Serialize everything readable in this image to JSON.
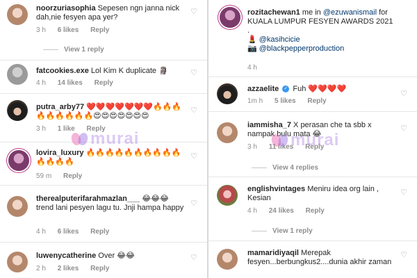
{
  "left": [
    {
      "user": "noorzuriasophia",
      "text": "Sepesen ngn janna nick dah,nie fesyen apa yer?",
      "time": "3 h",
      "likes": "6 likes",
      "reply": "Reply",
      "view_replies": "View 1 reply"
    },
    {
      "user": "fatcookies.exe",
      "text": "Lol Kim K duplicate 🗿",
      "time": "4 h",
      "likes": "14 likes",
      "reply": "Reply"
    },
    {
      "user": "putra_arby77",
      "text": "❤️❤️❤️❤️❤️❤️❤️🔥🔥🔥🔥🔥🔥🔥🔥🔥😍😍😍😍😍😍😍",
      "time": "3 h",
      "likes": "1 like",
      "reply": "Reply"
    },
    {
      "user": "lovira_luxury",
      "text": "🔥🔥🔥🔥🔥🔥🔥🔥🔥🔥🔥🔥🔥🔥",
      "time": "59 m",
      "reply": "Reply"
    },
    {
      "user": "therealputerifarahmazlan___",
      "text": "😂😂😂 trend lani pesyen lagu tu. Jnji hampa happy",
      "time": "4 h",
      "likes": "6 likes",
      "reply": "Reply"
    },
    {
      "user": "luwenycatherine",
      "text": "Over 😂😂",
      "time": "2 h",
      "likes": "2 likes",
      "reply": "Reply"
    }
  ],
  "right": {
    "post": {
      "user": "rozitachewan1",
      "text": "me in",
      "mention": "@ezuwanismail",
      "text2": "for KUALA LUMPUR FESYEN AWARDS 2021",
      "dot": ".",
      "line1_icon": "💄",
      "line1_mention": "@kasihcicie",
      "line2_icon": "📷",
      "line2_mention": "@blackpepperproduction",
      "time": "4 h"
    },
    "comments": [
      {
        "user": "azzaelite",
        "verified": "✓",
        "text": "Fuh ❤️❤️❤️❤️",
        "time": "1m h",
        "likes": "5 likes",
        "reply": "Reply"
      },
      {
        "user": "iammisha_7",
        "text": "X perasan che ta sbb x nampak bulu mata 😂",
        "time": "3 h",
        "likes": "11 likes",
        "reply": "Reply",
        "view_replies": "View 4 replies"
      },
      {
        "user": "englishvintages",
        "text": "Meniru idea org lain , Kesian",
        "time": "4 h",
        "likes": "24 likes",
        "reply": "Reply",
        "view_replies": "View 1 reply"
      },
      {
        "user": "mamaridiyaqil",
        "text": "Merepak fesyen...berbungkus2....dunia akhir zaman"
      }
    ]
  },
  "watermark": "murai",
  "icons": {
    "like": "heart-icon",
    "avatar": "avatar"
  }
}
